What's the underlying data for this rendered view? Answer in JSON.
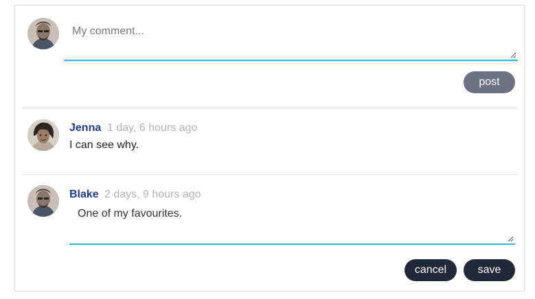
{
  "new_comment": {
    "placeholder": "My comment...",
    "post_label": "post"
  },
  "comments": [
    {
      "author": "Jenna",
      "time": "1 day, 6 hours ago",
      "text": "I can see why."
    },
    {
      "author": "Blake",
      "time": "2 days, 9 hours ago",
      "edit_value": "One of my favourites.",
      "cancel_label": "cancel",
      "save_label": "save"
    }
  ],
  "colors": {
    "author": "#1f3b9a",
    "focus_underline": "#29b6e6",
    "post_button": "#6b7280",
    "dark_button": "#1f2937"
  }
}
